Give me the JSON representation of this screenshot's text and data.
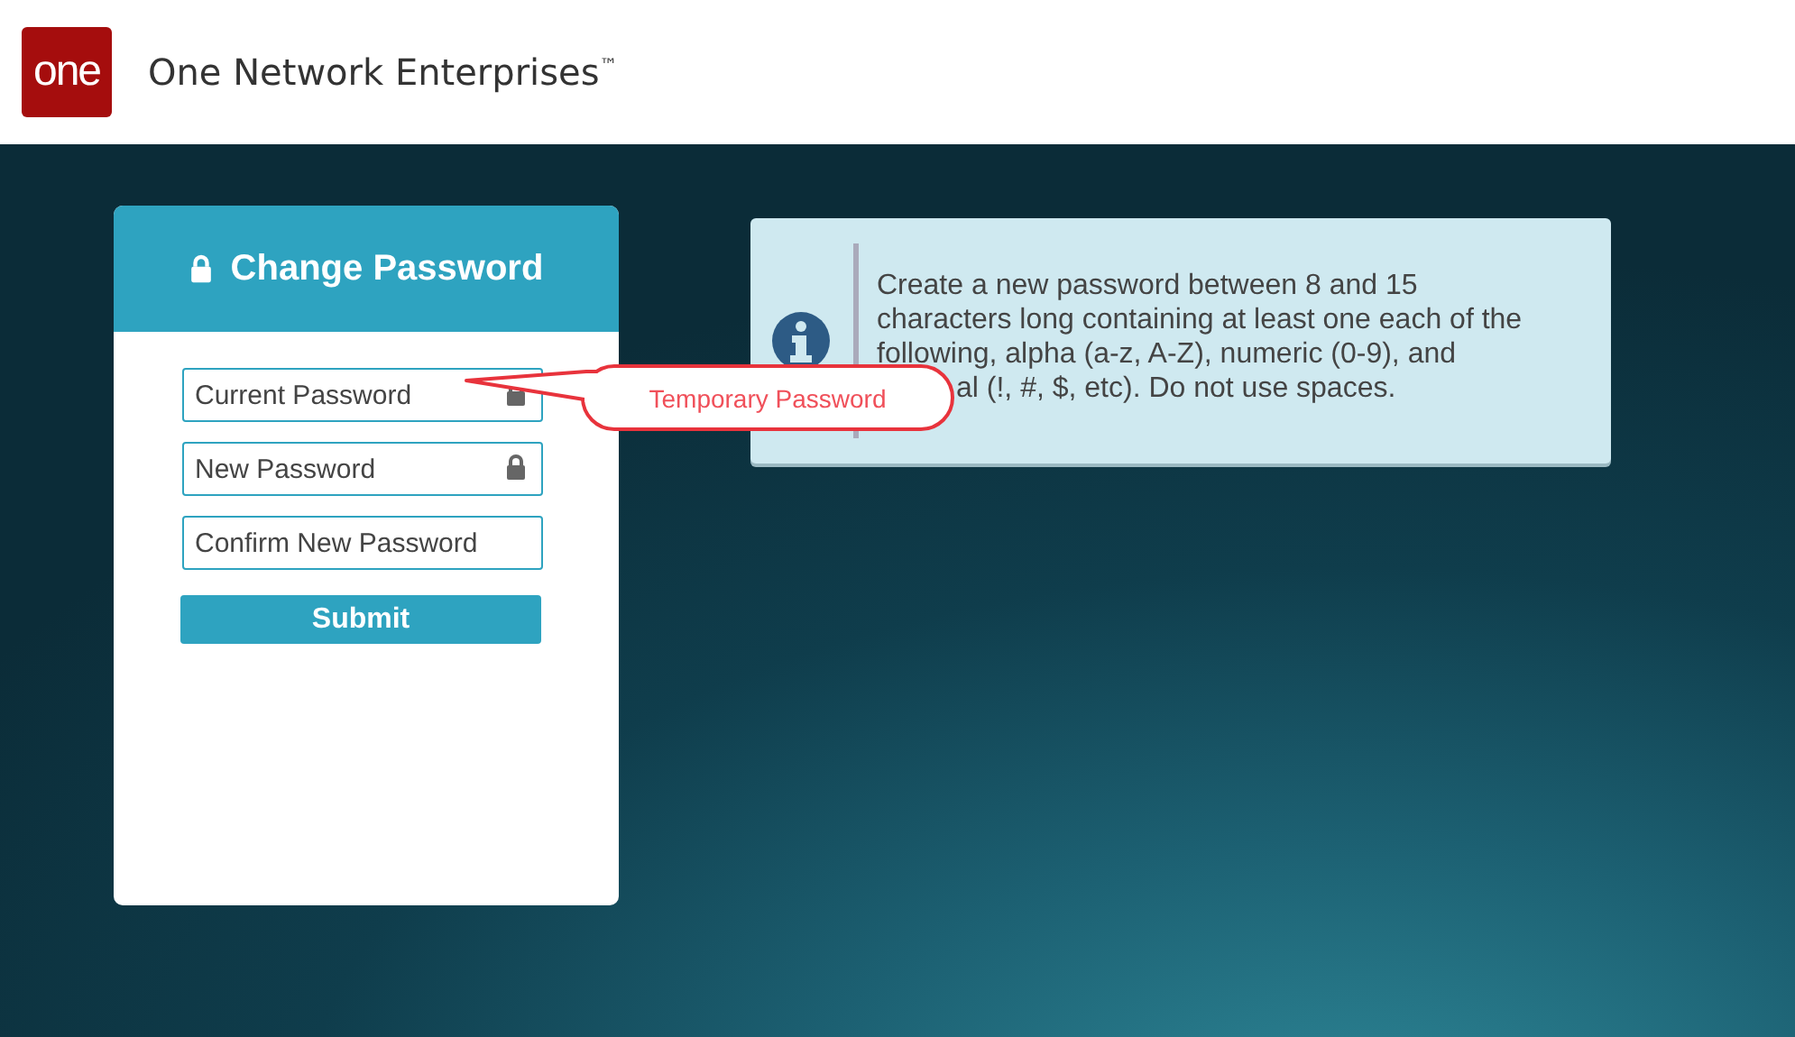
{
  "header": {
    "logo": "one",
    "title": "One Network Enterprises",
    "trademark": "™"
  },
  "card": {
    "title": "Change Password",
    "fields": [
      {
        "placeholder": "Current Password",
        "lock": true
      },
      {
        "placeholder": "New Password",
        "lock": true
      },
      {
        "placeholder": "Confirm New Password",
        "lock": false
      }
    ],
    "submit": "Submit"
  },
  "info": {
    "lines": [
      "Create a new password between 8 and 15",
      "characters long containing at least one each of the",
      "following, alpha (a-z, A-Z), numeric (0-9), and",
      "al (!, #, $, etc). Do not use spaces."
    ]
  },
  "callout": {
    "text": "Temporary Password"
  }
}
